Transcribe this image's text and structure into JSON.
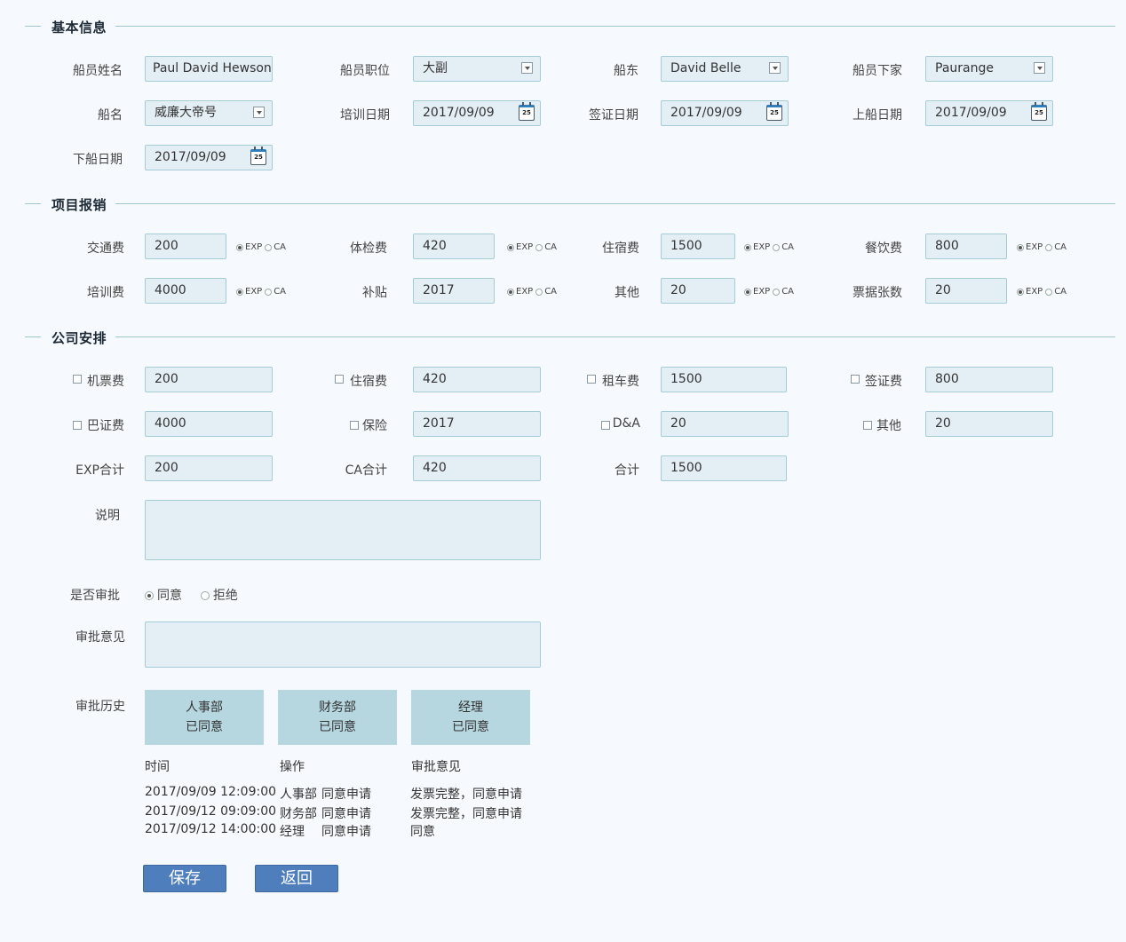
{
  "sections": {
    "basic": "基本信息",
    "reimburse": "项目报销",
    "company": "公司安排"
  },
  "basic": {
    "name_label": "船员姓名",
    "name_value": "Paul David Hewson",
    "position_label": "船员职位",
    "position_value": "大副",
    "owner_label": "船东",
    "owner_value": "David Belle",
    "family_label": "船员下家",
    "family_value": "Paurange",
    "ship_label": "船名",
    "ship_value": "威廉大帝号",
    "training_label": "培训日期",
    "training_value": "2017/09/09",
    "visa_label": "签证日期",
    "visa_value": "2017/09/09",
    "board_label": "上船日期",
    "board_value": "2017/09/09",
    "leave_label": "下船日期",
    "leave_value": "2017/09/09",
    "cal_day": "25"
  },
  "reimburse": {
    "exp": "EXP",
    "ca": "CA",
    "traffic_label": "交通费",
    "traffic_value": "200",
    "medical_label": "体检费",
    "medical_value": "420",
    "lodging_label": "住宿费",
    "lodging_value": "1500",
    "meal_label": "餐饮费",
    "meal_value": "800",
    "training_label": "培训费",
    "training_value": "4000",
    "subsidy_label": "补贴",
    "subsidy_value": "2017",
    "other_label": "其他",
    "other_value": "20",
    "receipts_label": "票据张数",
    "receipts_value": "20"
  },
  "company": {
    "air_label": "机票费",
    "air_value": "200",
    "lodging_label": "住宿费",
    "lodging_value": "420",
    "car_label": "租车费",
    "car_value": "1500",
    "visa_label": "签证费",
    "visa_value": "800",
    "bavisa_label": "巴证费",
    "bavisa_value": "4000",
    "insurance_label": "保险",
    "insurance_value": "2017",
    "da_label": "D&A",
    "da_value": "20",
    "other_label": "其他",
    "other_value": "20",
    "exp_total_label": "EXP合计",
    "exp_total_value": "200",
    "ca_total_label": "CA合计",
    "ca_total_value": "420",
    "total_label": "合计",
    "total_value": "1500",
    "note_label": "说明",
    "approve_q_label": "是否审批",
    "agree": "同意",
    "reject": "拒绝",
    "opinion_label": "审批意见",
    "history_label": "审批历史"
  },
  "steps": [
    {
      "dept": "人事部",
      "status": "已同意"
    },
    {
      "dept": "财务部",
      "status": "已同意"
    },
    {
      "dept": "经理",
      "status": "已同意"
    }
  ],
  "history": {
    "headers": {
      "time": "时间",
      "op": "操作",
      "opinion": "审批意见"
    },
    "rows": [
      {
        "time": "2017/09/09 12:09:00",
        "dept": "人事部",
        "action": "同意申请",
        "opinion": "发票完整，同意申请"
      },
      {
        "time": "2017/09/12 09:09:00",
        "dept": "财务部",
        "action": "同意申请",
        "opinion": "发票完整，同意申请"
      },
      {
        "time": "2017/09/12 14:00:00",
        "dept": "经理",
        "action": "同意申请",
        "opinion": "同意"
      }
    ]
  },
  "buttons": {
    "save": "保存",
    "back": "返回"
  }
}
